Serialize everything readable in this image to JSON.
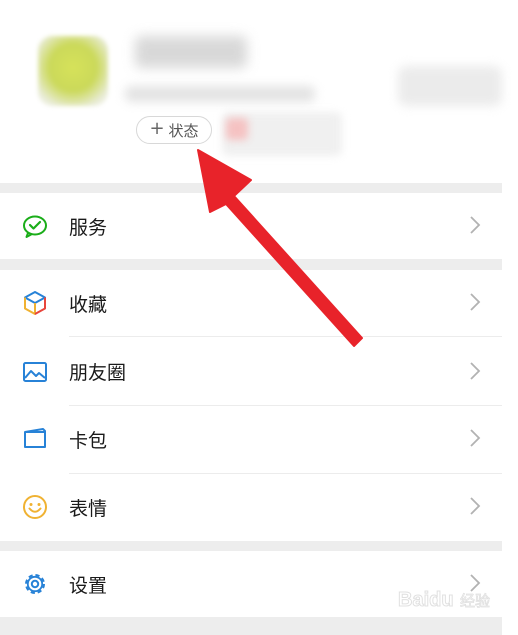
{
  "profile": {
    "status_plus": "+",
    "status_label": "状态"
  },
  "menu": {
    "services": "服务",
    "favorites": "收藏",
    "moments": "朋友圈",
    "cards": "卡包",
    "stickers": "表情",
    "settings": "设置"
  },
  "colors": {
    "services_icon": "#1aad19",
    "moments_icon": "#2782d7",
    "cards_icon": "#2782d7",
    "stickers_icon": "#f0b232",
    "settings_icon": "#2782d7",
    "arrow": "#e8232a",
    "section_gap": "#ededed"
  },
  "icons": {
    "services": "wechat-pay-icon",
    "favorites": "cube-icon",
    "moments": "image-icon",
    "cards": "card-icon",
    "stickers": "smiley-icon",
    "settings": "gear-icon",
    "chevron": "chevron-right-icon"
  },
  "watermark": {
    "brand": "Baidu",
    "subtitle": "经验"
  }
}
